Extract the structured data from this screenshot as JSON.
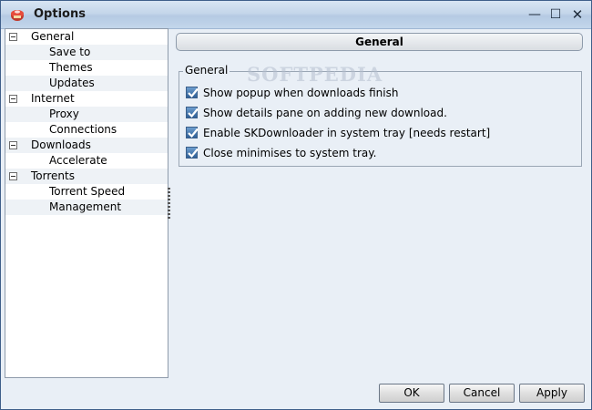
{
  "window": {
    "title": "Options",
    "controls": {
      "minimize": "—",
      "maximize": "☐",
      "close": "✕"
    }
  },
  "tree": {
    "items": [
      {
        "label": "General",
        "level": 0
      },
      {
        "label": "Save to",
        "level": 1
      },
      {
        "label": "Themes",
        "level": 1
      },
      {
        "label": "Updates",
        "level": 1
      },
      {
        "label": "Internet",
        "level": 0
      },
      {
        "label": "Proxy",
        "level": 1
      },
      {
        "label": "Connections",
        "level": 1
      },
      {
        "label": "Downloads",
        "level": 0
      },
      {
        "label": "Accelerate",
        "level": 1
      },
      {
        "label": "Torrents",
        "level": 0
      },
      {
        "label": "Torrent Speed",
        "level": 1
      },
      {
        "label": "Management",
        "level": 1
      }
    ]
  },
  "panel": {
    "header": "General",
    "group_label": "General",
    "watermark": "SOFTPEDIA",
    "options": [
      {
        "label": "Show popup when downloads finish",
        "checked": true
      },
      {
        "label": "Show details pane on adding new download.",
        "checked": true
      },
      {
        "label": "Enable SKDownloader in system tray [needs restart]",
        "checked": true
      },
      {
        "label": "Close minimises to system tray.",
        "checked": true
      }
    ]
  },
  "buttons": {
    "ok": "OK",
    "cancel": "Cancel",
    "apply": "Apply"
  }
}
